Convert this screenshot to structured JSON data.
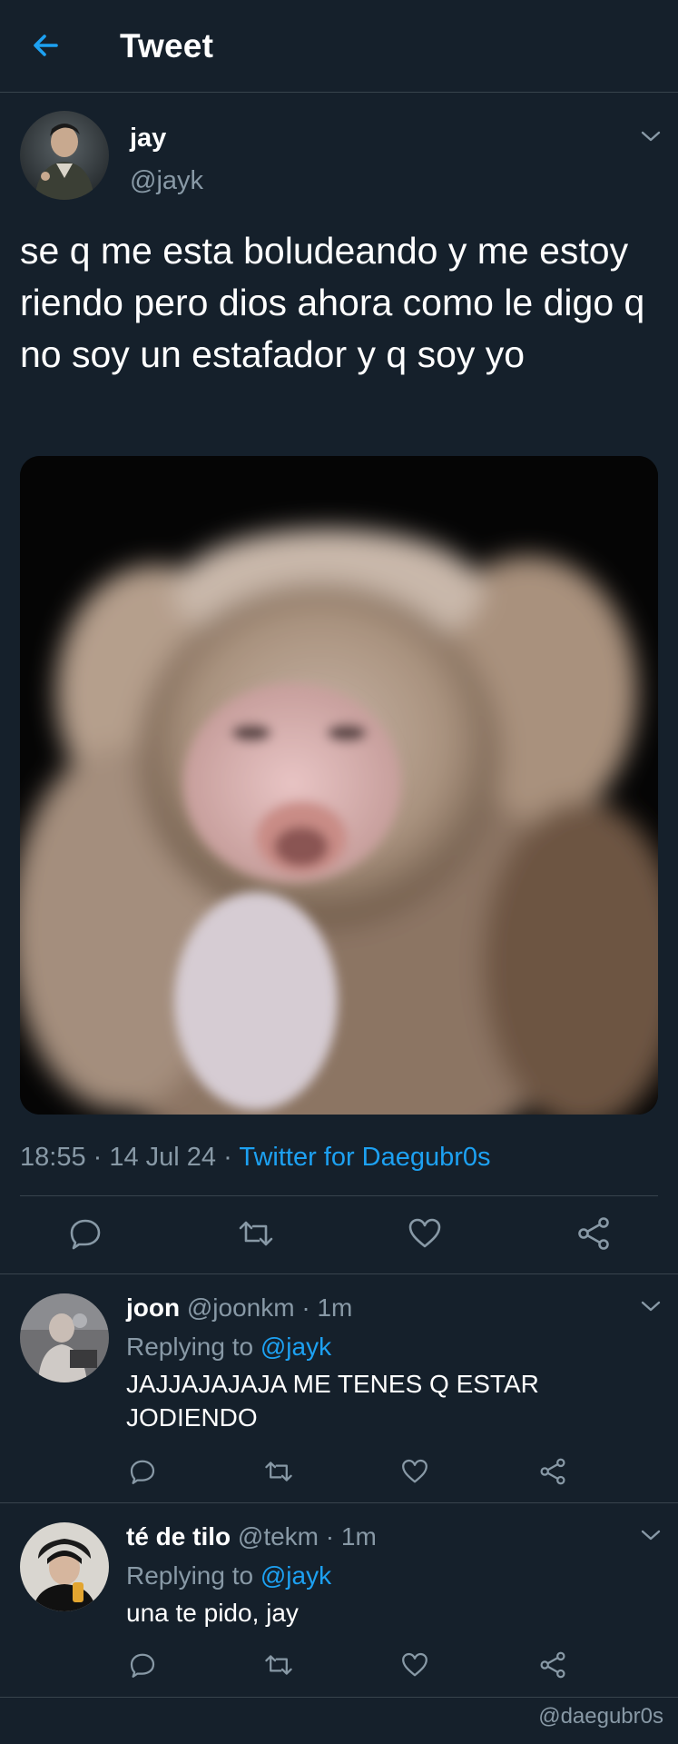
{
  "header": {
    "title": "Tweet",
    "back_icon": "arrow-left-icon"
  },
  "tweet": {
    "author": {
      "name": "jay",
      "handle": "@jayk"
    },
    "text": "se q me esta boludeando y me estoy riendo pero dios ahora como le digo q no soy un estafador y q soy yo",
    "time": "18:55",
    "date": "14 Jul 24",
    "source": "Twitter for Daegubr0s",
    "actions": [
      "reply-icon",
      "retweet-icon",
      "like-icon",
      "share-icon"
    ]
  },
  "replies": [
    {
      "name": "joon",
      "handle": "@joonkm",
      "time": "1m",
      "replying_label": "Replying to",
      "replying_to": "@jayk",
      "text": "JAJJAJAJAJA ME TENES Q ESTAR JODIENDO"
    },
    {
      "name": "té de tilo",
      "handle": "@tekm",
      "time": "1m",
      "replying_label": "Replying to",
      "replying_to": "@jayk",
      "text": "una te pido, jay"
    }
  ],
  "watermark": "@daegubr0s",
  "colors": {
    "background": "#15202b",
    "accent": "#1da1f2",
    "secondary_text": "#8899a6",
    "divider": "#38444d"
  }
}
